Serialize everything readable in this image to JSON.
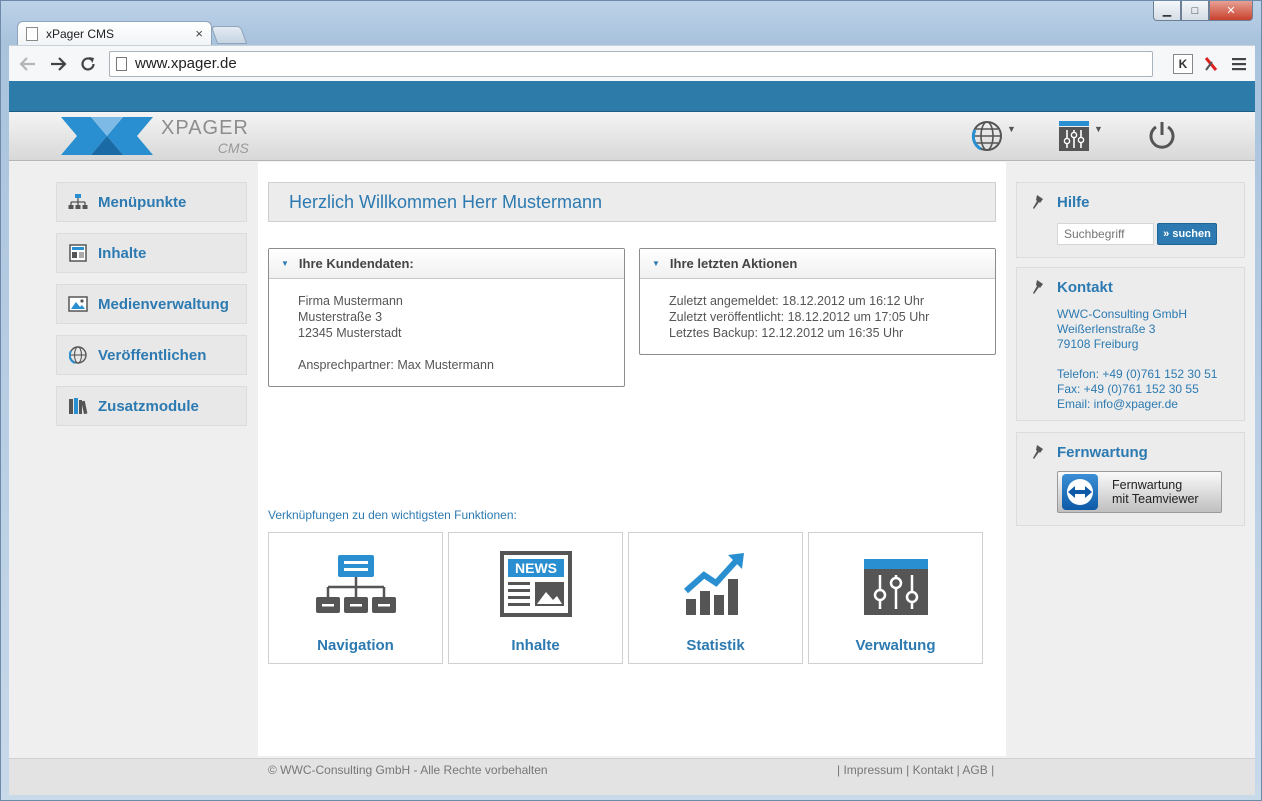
{
  "browser": {
    "tab_title": "xPager CMS",
    "tab_close": "×",
    "url": "www.xpager.de",
    "ext_k": "K",
    "window_controls": {
      "minimize": "▁",
      "maximize": "□",
      "close": "✕"
    }
  },
  "header": {
    "logo_name": "XPAGER",
    "logo_sub": "CMS"
  },
  "sidebar": {
    "items": [
      {
        "label": "Menüpunkte",
        "icon": "sitemap-icon"
      },
      {
        "label": "Inhalte",
        "icon": "content-icon"
      },
      {
        "label": "Medienverwaltung",
        "icon": "image-icon"
      },
      {
        "label": "Veröffentlichen",
        "icon": "globe-icon"
      },
      {
        "label": "Zusatzmodule",
        "icon": "books-icon"
      }
    ]
  },
  "main": {
    "welcome": "Herzlich Willkommen Herr Mustermann",
    "customer": {
      "title": "Ihre Kundendaten:",
      "company": "Firma Mustermann",
      "street": "Musterstraße 3",
      "city": "12345 Musterstadt",
      "contact": "Ansprechpartner: Max Mustermann"
    },
    "actions": {
      "title": "Ihre letzten Aktionen",
      "lines": [
        "Zuletzt angemeldet: 18.12.2012 um 16:12 Uhr",
        "Zuletzt veröffentlicht: 18.12.2012 um 17:05 Uhr",
        "Letztes Backup: 12.12.2012 um 16:35 Uhr"
      ]
    },
    "shortcuts_label": "Verknüpfungen zu den wichtigsten Funktionen:",
    "tiles": [
      {
        "label": "Navigation",
        "icon": "navigation-tree-icon"
      },
      {
        "label": "Inhalte",
        "icon": "newspaper-icon",
        "badge": "NEWS"
      },
      {
        "label": "Statistik",
        "icon": "statistics-icon"
      },
      {
        "label": "Verwaltung",
        "icon": "sliders-icon"
      }
    ]
  },
  "right": {
    "help": {
      "title": "Hilfe",
      "search_placeholder": "Suchbegriff",
      "search_button": "» suchen"
    },
    "contact": {
      "title": "Kontakt",
      "lines": [
        "WWC-Consulting GmbH",
        "Weißerlenstraße 3",
        "79108 Freiburg",
        "",
        "Telefon: +49 (0)761 152 30 51",
        "Fax: +49 (0)761 152 30 55",
        "Email: info@xpager.de"
      ]
    },
    "remote": {
      "title": "Fernwartung",
      "button_line1": "Fernwartung",
      "button_line2": "mit Teamviewer"
    }
  },
  "footer": {
    "copyright": "© WWC-Consulting GmbH - Alle Rechte vorbehalten",
    "links": "| Impressum | Kontakt | AGB |"
  },
  "colors": {
    "accent": "#2c7ab1",
    "topbar": "#2d7ba8",
    "logo_blue": "#2a8fd0"
  }
}
